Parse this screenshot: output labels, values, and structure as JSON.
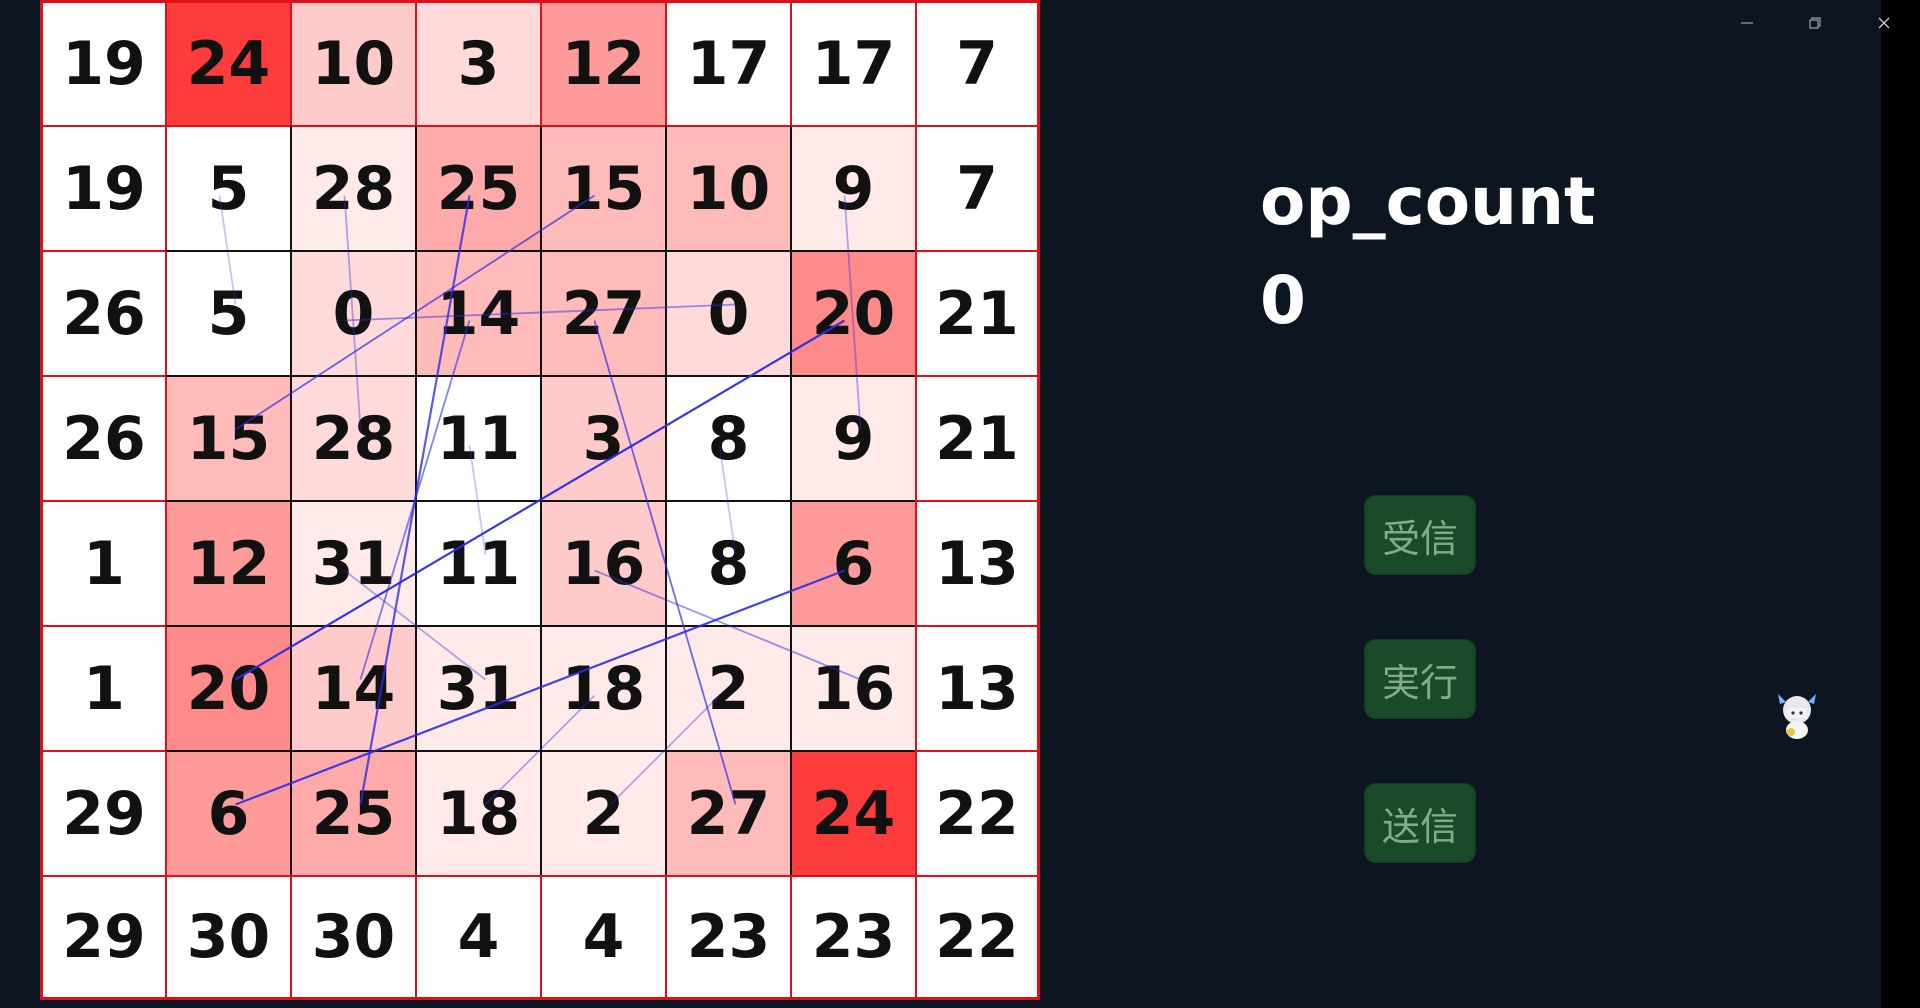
{
  "grid": {
    "values": [
      [
        19,
        24,
        10,
        3,
        12,
        17,
        17,
        7
      ],
      [
        19,
        5,
        28,
        25,
        15,
        10,
        9,
        7
      ],
      [
        26,
        5,
        0,
        14,
        27,
        0,
        20,
        21
      ],
      [
        26,
        15,
        28,
        11,
        3,
        8,
        9,
        21
      ],
      [
        1,
        12,
        31,
        11,
        16,
        8,
        6,
        13
      ],
      [
        1,
        20,
        14,
        31,
        18,
        2,
        16,
        13
      ],
      [
        29,
        6,
        25,
        18,
        2,
        27,
        24,
        22
      ],
      [
        29,
        30,
        30,
        4,
        4,
        23,
        23,
        22
      ]
    ],
    "heat_levels": [
      [
        0,
        10,
        3,
        2,
        6,
        0,
        0,
        0
      ],
      [
        0,
        0,
        1,
        5,
        4,
        4,
        1,
        0
      ],
      [
        0,
        0,
        2,
        4,
        4,
        2,
        7,
        0
      ],
      [
        0,
        4,
        2,
        0,
        3,
        0,
        1,
        0
      ],
      [
        0,
        6,
        1,
        0,
        3,
        0,
        6,
        0
      ],
      [
        0,
        7,
        3,
        1,
        1,
        1,
        1,
        0
      ],
      [
        0,
        6,
        5,
        1,
        1,
        4,
        10,
        0
      ],
      [
        0,
        0,
        0,
        0,
        0,
        0,
        0,
        0
      ]
    ]
  },
  "panel": {
    "label": "op_count",
    "value": "0"
  },
  "buttons": {
    "receive": "受信",
    "execute": "実行",
    "send": "送信"
  },
  "window_controls": {
    "minimize": "minimize-icon",
    "restore": "restore-icon",
    "close": "close-icon"
  },
  "colors": {
    "app_bg": "#0d1520",
    "button_bg": "#1a4a2a",
    "button_text": "#7fae85",
    "group_border": "#e0101a",
    "pair_line": "#2a2ae8"
  }
}
